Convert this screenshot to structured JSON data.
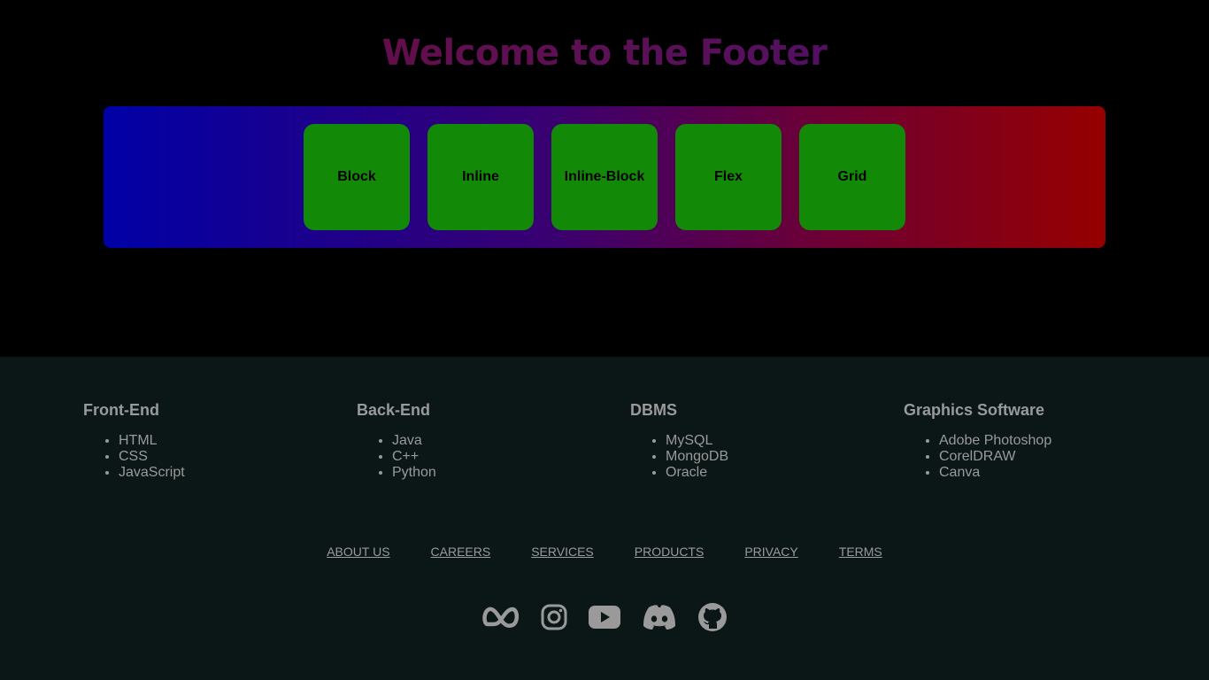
{
  "hero": {
    "title": "Welcome to the Footer"
  },
  "boxes": [
    {
      "label": "Block"
    },
    {
      "label": "Inline"
    },
    {
      "label": "Inline-Block"
    },
    {
      "label": "Flex"
    },
    {
      "label": "Grid"
    }
  ],
  "colors": {
    "page_background": "#000000",
    "strip_gradient_start": "#0000a6",
    "strip_gradient_end": "#960000",
    "box_background": "#128a07",
    "footer_background": "#0b1616",
    "footer_text": "#9a9a9a"
  },
  "footer": {
    "columns": [
      {
        "heading": "Front-End",
        "items": [
          "HTML",
          "CSS",
          "JavaScript"
        ]
      },
      {
        "heading": "Back-End",
        "items": [
          "Java",
          "C++",
          "Python"
        ]
      },
      {
        "heading": "DBMS",
        "items": [
          "MySQL",
          "MongoDB",
          "Oracle"
        ]
      },
      {
        "heading": "Graphics Software",
        "items": [
          "Adobe Photoshop",
          "CorelDRAW",
          "Canva"
        ]
      }
    ],
    "links": [
      "ABOUT US",
      "CAREERS",
      "SERVICES",
      "PRODUCTS",
      "PRIVACY",
      "TERMS"
    ],
    "social_icons": [
      "meta-icon",
      "instagram-icon",
      "youtube-icon",
      "discord-icon",
      "github-icon"
    ]
  }
}
